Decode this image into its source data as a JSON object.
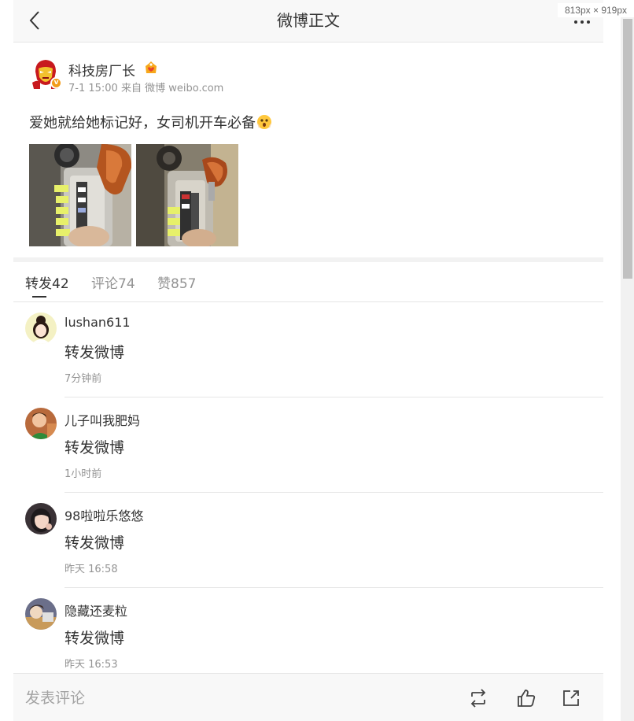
{
  "viewport_label": "813px × 919px",
  "header": {
    "title": "微博正文"
  },
  "post": {
    "author": "科技房厂长",
    "meta": "7-1 15:00 来自 微博 weibo.com",
    "text": "爱她就给她标记好，女司机开车必备"
  },
  "tabs": [
    {
      "label": "转发42",
      "active": true
    },
    {
      "label": "评论74",
      "active": false
    },
    {
      "label": "赞857",
      "active": false
    }
  ],
  "reposts": [
    {
      "user": "lushan611",
      "text": "转发微博",
      "time": "7分钟前"
    },
    {
      "user": "儿子叫我肥妈",
      "text": "转发微博",
      "time": "1小时前"
    },
    {
      "user": "98啦啦乐悠悠",
      "text": "转发微博",
      "time": "昨天 16:58"
    },
    {
      "user": "隐藏还麦粒",
      "text": "转发微博",
      "time": "昨天 16:53"
    }
  ],
  "footer": {
    "comment_placeholder": "发表评论"
  },
  "colors": {
    "text_primary": "#333333",
    "text_secondary": "#939393",
    "divider": "#e6e6e6",
    "verified_badge": "#f29c1a"
  }
}
